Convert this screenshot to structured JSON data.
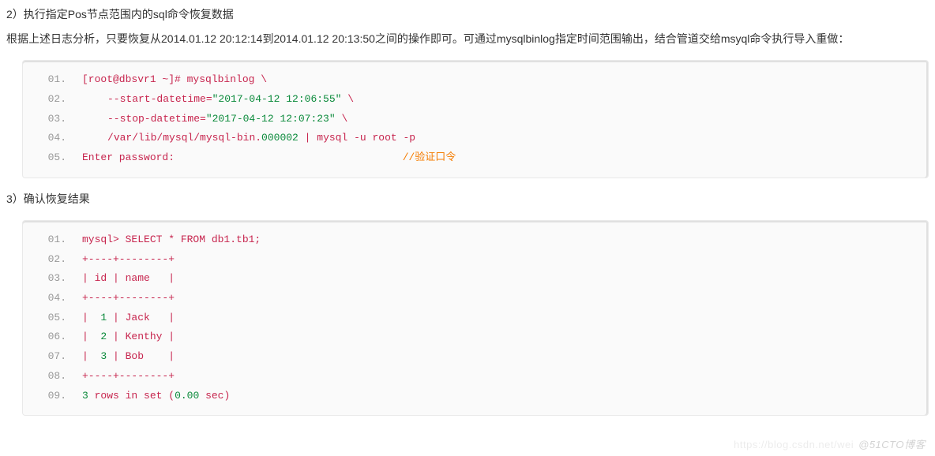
{
  "sections": {
    "s2_title": "2）执行指定Pos节点范围内的sql命令恢复数据",
    "s2_desc": "根据上述日志分析，只要恢复从2014.01.12 20:12:14到2014.01.12 20:13:50之间的操作即可。可通过mysqlbinlog指定时间范围输出，结合管道交给msyql命令执行导入重做：",
    "s3_title": "3）确认恢复结果"
  },
  "code1": {
    "n1": "01.",
    "n2": "02.",
    "n3": "03.",
    "n4": "04.",
    "n5": "05.",
    "l1_a": "[root@dbsvr1 ~]# mysqlbinlog \\",
    "l2_a": "--start-datetime=",
    "l2_b": "\"2017-04-12 12:06:55\"",
    "l2_c": " \\",
    "l3_a": "--stop-datetime=",
    "l3_b": "\"2017-04-12 12:07:23\"",
    "l3_c": " \\",
    "l4_a": "/",
    "l4_b": "var",
    "l4_c": "/lib/mysql/mysql-bin.",
    "l4_d": "000002",
    "l4_e": " | mysql -u root -p",
    "l5_a": "Enter password:",
    "l5_pad": "                                     ",
    "l5_b": "//验证口令"
  },
  "code2": {
    "n1": "01.",
    "n2": "02.",
    "n3": "03.",
    "n4": "04.",
    "n5": "05.",
    "n6": "06.",
    "n7": "07.",
    "n8": "08.",
    "n9": "09.",
    "l1_a": "mysql> SELECT * FROM db1.tb1;",
    "l2_a": "+----+--------+",
    "l3_a": "| id | name   |",
    "l4_a": "+----+--------+",
    "l5_a": "|  ",
    "l5_b": "1",
    "l5_c": " | Jack   |",
    "l6_a": "|  ",
    "l6_b": "2",
    "l6_c": " | Kenthy |",
    "l7_a": "|  ",
    "l7_b": "3",
    "l7_c": " | Bob    |",
    "l8_a": "+----+--------+",
    "l9_a": "3",
    "l9_b": " rows ",
    "l9_c": "in",
    "l9_d": " ",
    "l9_e": "set",
    "l9_f": " (",
    "l9_g": "0.00",
    "l9_h": " sec)"
  },
  "watermark": {
    "csdn": "https://blog.csdn.net/wei",
    "cto": "@51CTO博客"
  }
}
